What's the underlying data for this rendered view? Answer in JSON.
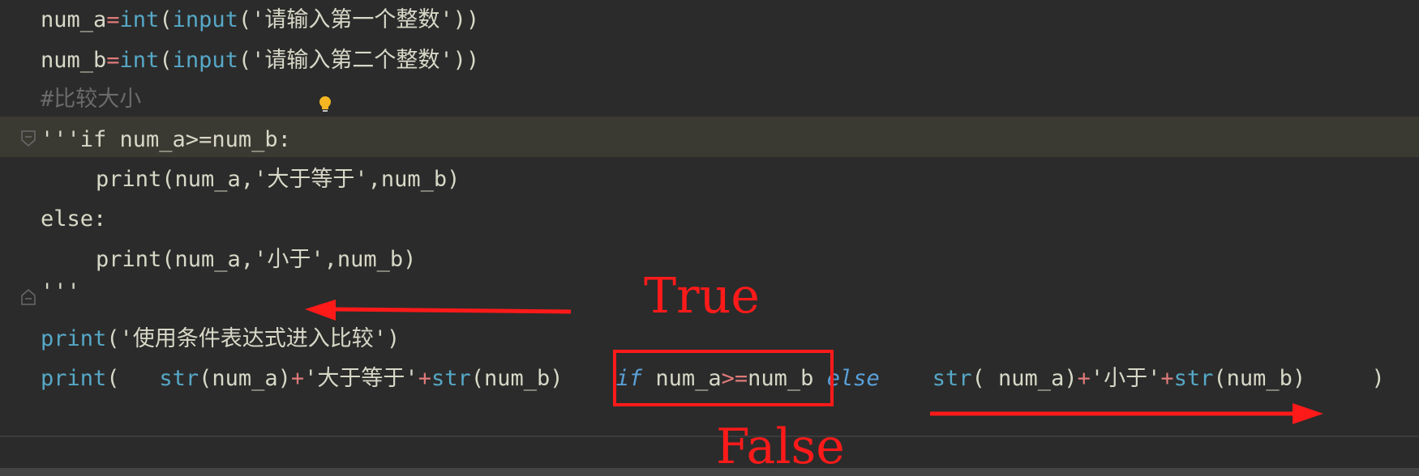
{
  "code": {
    "line1": {
      "var": "num_a",
      "eq": "=",
      "fn_int": "int",
      "p_open": "(",
      "fn_input": "input",
      "arg": "('请输入第一个整数'))"
    },
    "line2": {
      "var": "num_b",
      "eq": "=",
      "fn_int": "int",
      "p_open": "(",
      "fn_input": "input",
      "arg": "('请输入第二个整数'))"
    },
    "line3": {
      "comment": "#比较大小"
    },
    "line4": {
      "text": "'''if num_a>=num_b:"
    },
    "line5": {
      "text": "print(num_a,'大于等于',num_b)"
    },
    "line6": {
      "text": "else:"
    },
    "line7": {
      "text": "print(num_a,'小于',num_b)"
    },
    "line8": {
      "text": "'''"
    },
    "line9": {
      "fn_print": "print",
      "rest": "('使用条件表达式进入比较')"
    },
    "line10": {
      "fn_print": "print",
      "p_open": "(",
      "fn_str1": "str",
      "a1": "(num_a)",
      "plus1": "+",
      "s1": "'大于等于'",
      "plus2": "+",
      "fn_str2": "str",
      "a2": "(num_b)",
      "kw_if": "if",
      "cond_a": "num_a",
      "cond_op": ">=",
      "cond_b": "num_b",
      "kw_else": "else",
      "fn_str3": "str",
      "a3": "( num_a)",
      "plus3": "+",
      "s2": "'小于'",
      "plus4": "+",
      "fn_str4": "str",
      "a4": "(num_b)",
      "p_close": ")"
    }
  },
  "annotations": {
    "true_label": "True",
    "false_label": "False"
  },
  "colors": {
    "background": "#2b2b2b",
    "current_line": "#3b3a32",
    "annotation_red": "#ff1a1a",
    "builtin": "#56a8c7",
    "operator": "#e07a7a",
    "text": "#d8d8c8",
    "comment": "#6b6b6b"
  },
  "icons": {
    "intention": "lightbulb-icon",
    "fold_start": "fold-start-icon",
    "fold_end": "fold-end-icon"
  }
}
